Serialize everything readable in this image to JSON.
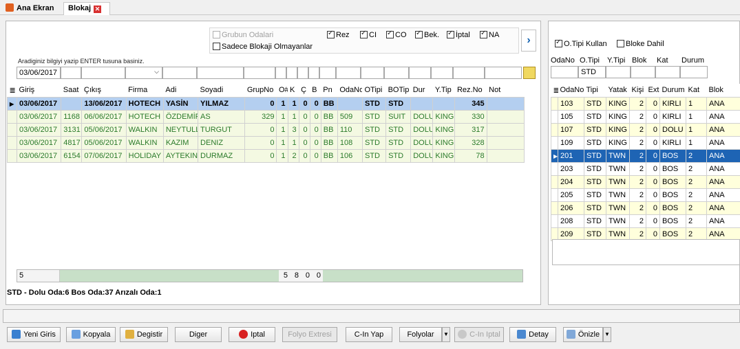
{
  "tabs": [
    {
      "label": "Ana Ekran",
      "icon": "home-icon"
    },
    {
      "label": "Blokaj",
      "icon": "close-icon"
    }
  ],
  "filters": {
    "grubun_odalari": "Grubun Odalari",
    "sadece_blokaji": "Sadece Blokaji Olmayanlar",
    "rez": "Rez",
    "ci": "CI",
    "co": "CO",
    "bek": "Bek.",
    "iptal": "İptal",
    "na": "NA"
  },
  "hint": "Aradiginiz bilgiyi yazip ENTER tusuna basiniz.",
  "date_filter": "03/06/2017",
  "grid": {
    "columns": [
      "Giriş",
      "Saat",
      "Çıkış",
      "Firma",
      "Adi",
      "Soyadi",
      "GrupNo",
      "O#",
      "K",
      "Ç",
      "B",
      "Pn",
      "OdaNo",
      "OTipi",
      "BOTip",
      "Dur",
      "Y.Tip",
      "Rez.No",
      "Not"
    ],
    "rows": [
      [
        "03/06/2017",
        "",
        "13/06/2017",
        "HOTECH",
        "YASİN",
        "YILMAZ",
        "0",
        "1",
        "1",
        "0",
        "0",
        "BB",
        "",
        "STD",
        "STD",
        "",
        "",
        "345",
        ""
      ],
      [
        "03/06/2017",
        "1168",
        "06/06/2017",
        "HOTECH",
        "ÖZDEMİR",
        "AS",
        "329",
        "1",
        "1",
        "0",
        "0",
        "BB",
        "509",
        "STD",
        "SUIT",
        "DOLU",
        "KING",
        "330",
        ""
      ],
      [
        "03/06/2017",
        "3131",
        "05/06/2017",
        "WALKIN",
        "NEYTULLAH",
        "TURGUT",
        "0",
        "1",
        "3",
        "0",
        "0",
        "BB",
        "110",
        "STD",
        "STD",
        "DOLU",
        "KING",
        "317",
        ""
      ],
      [
        "03/06/2017",
        "4817",
        "05/06/2017",
        "WALKIN",
        "KAZIM",
        "DENIZ",
        "0",
        "1",
        "1",
        "0",
        "0",
        "BB",
        "108",
        "STD",
        "STD",
        "DOLU",
        "KING",
        "328",
        ""
      ],
      [
        "03/06/2017",
        "6154",
        "07/06/2017",
        "HOLIDAY",
        "AYTEKIN",
        "DURMAZ",
        "0",
        "1",
        "2",
        "0",
        "0",
        "BB",
        "106",
        "STD",
        "STD",
        "DOLU",
        "KING",
        "78",
        ""
      ]
    ],
    "summary": {
      "count": "5",
      "o": "5",
      "k": "8",
      "c": "0",
      "b": "0"
    }
  },
  "status_line": "STD -  Dolu Oda:6 Bos Oda:37 Arızalı Oda:1",
  "right": {
    "otipi_kullan": "O.Tipi Kullan",
    "bloke_dahil": "Bloke Dahil",
    "filter_labels": [
      "OdaNo",
      "O.Tipi",
      "Y.Tipi",
      "Blok",
      "Kat",
      "Durum"
    ],
    "otipi_value": "STD",
    "columns": [
      "OdaNo",
      "Tipi",
      "Yatak",
      "Kişi",
      "Ext",
      "Durum",
      "Kat",
      "Blok"
    ],
    "rows": [
      [
        "103",
        "STD",
        "KING",
        "2",
        "0",
        "KIRLI",
        "1",
        "ANA"
      ],
      [
        "105",
        "STD",
        "KING",
        "2",
        "0",
        "KIRLI",
        "1",
        "ANA"
      ],
      [
        "107",
        "STD",
        "KING",
        "2",
        "0",
        "DOLU",
        "1",
        "ANA"
      ],
      [
        "109",
        "STD",
        "KING",
        "2",
        "0",
        "KIRLI",
        "1",
        "ANA"
      ],
      [
        "201",
        "STD",
        "TWN",
        "2",
        "0",
        "BOS",
        "2",
        "ANA"
      ],
      [
        "203",
        "STD",
        "TWN",
        "2",
        "0",
        "BOS",
        "2",
        "ANA"
      ],
      [
        "204",
        "STD",
        "TWN",
        "2",
        "0",
        "BOS",
        "2",
        "ANA"
      ],
      [
        "205",
        "STD",
        "TWN",
        "2",
        "0",
        "BOS",
        "2",
        "ANA"
      ],
      [
        "206",
        "STD",
        "TWN",
        "2",
        "0",
        "BOS",
        "2",
        "ANA"
      ],
      [
        "208",
        "STD",
        "TWN",
        "2",
        "0",
        "BOS",
        "2",
        "ANA"
      ],
      [
        "209",
        "STD",
        "TWN",
        "2",
        "0",
        "BOS",
        "2",
        "ANA"
      ]
    ]
  },
  "buttons": {
    "yeni_giris": "Yeni Giris",
    "kopyala": "Kopyala",
    "degistir": "Degistir",
    "diger": "Diger",
    "iptal": "Iptal",
    "folyo_ekstresi": "Folyo Extresi",
    "cin_yap": "C-In Yap",
    "folyolar": "Folyolar",
    "cin_iptal": "C-In Iptal",
    "detay": "Detay",
    "onizle": "Önizle"
  },
  "colors": {
    "selected_row": "#b4cff0",
    "blue_row": "#1e64b4",
    "green_text": "#2a7a2a",
    "summary_bar": "#c8e0c8"
  }
}
